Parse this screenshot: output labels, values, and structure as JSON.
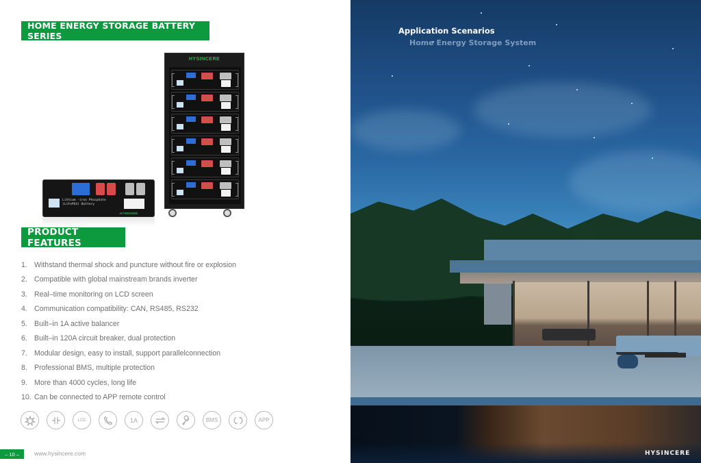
{
  "left_page": {
    "series_banner": "HOME ENERGY STORAGE BATTERY SERIES",
    "features_banner": "PRODUCT FEATURES",
    "features": [
      {
        "num": "1.",
        "text": "Withstand thermal shock and puncture without fire or explosion"
      },
      {
        "num": "2.",
        "text": "Compatible with global mainstream brands inverter"
      },
      {
        "num": "3.",
        "text": "Real–time monitoring on LCD screen"
      },
      {
        "num": "4.",
        "text": "Communication compatibility: CAN, RS485, RS232"
      },
      {
        "num": "5.",
        "text": "Built–in 1A active balancer"
      },
      {
        "num": "6.",
        "text": "Built–in 120A circuit breaker, dual protection"
      },
      {
        "num": "7.",
        "text": "Modular design, easy to install, support parallelconnection"
      },
      {
        "num": "8.",
        "text": "Professional BMS, multiple protection"
      },
      {
        "num": "9.",
        "text": "More than 4000 cycles, long life"
      },
      {
        "num": "10.",
        "text": "Can be connected to APP remote control"
      }
    ],
    "feature_icons": [
      {
        "name": "explosion-proof-icon",
        "glyph": ""
      },
      {
        "name": "breaker-icon",
        "glyph": ""
      },
      {
        "name": "lcd-icon",
        "glyph": "LCD"
      },
      {
        "name": "phone-icon",
        "glyph": ""
      },
      {
        "name": "balancer-icon",
        "glyph": "1A"
      },
      {
        "name": "parallel-arrows-icon",
        "glyph": ""
      },
      {
        "name": "wrench-icon",
        "glyph": ""
      },
      {
        "name": "bms-icon",
        "glyph": "BMS"
      },
      {
        "name": "cycle-icon",
        "glyph": ""
      },
      {
        "name": "app-icon",
        "glyph": "APP"
      }
    ],
    "rack_logo": "HYSINCERE",
    "module_text_line1": "Lithium -iron Phosphate",
    "module_text_line2": "(LiFePO4) Battery",
    "module_brand": "HYSINCERE",
    "page_number": "– 10 –",
    "website": "www.hysincere.com"
  },
  "right_page": {
    "title": "Application Scenarios",
    "subtitle": "Home Energy Storage System",
    "brand": "HYSINCERE"
  },
  "colors": {
    "brand_green": "#0d9a3e",
    "feature_text": "#6f6f6f",
    "sky_blue": "#2a68a3"
  }
}
